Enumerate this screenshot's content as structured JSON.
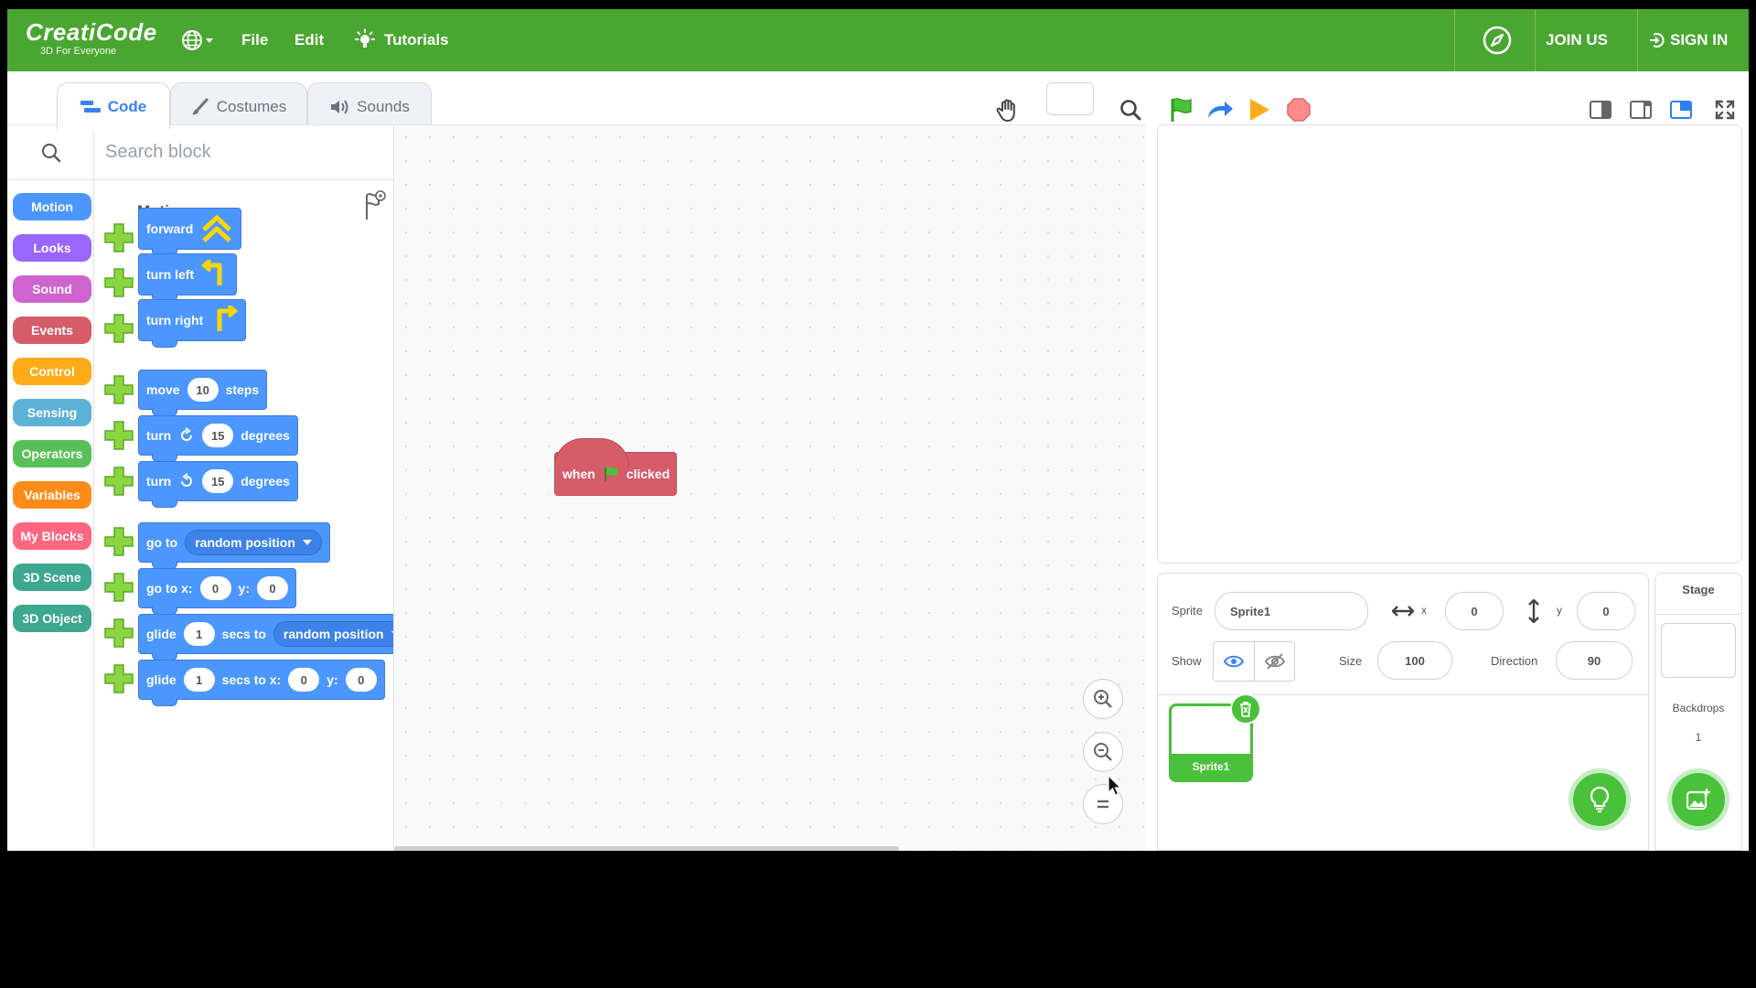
{
  "topbar": {
    "brand": "CreatiCode",
    "tagline": "3D For Everyone",
    "menu_file": "File",
    "menu_edit": "Edit",
    "menu_tutorials": "Tutorials",
    "join_us": "JOIN US",
    "sign_in": "SIGN IN"
  },
  "tabs": {
    "code": "Code",
    "costumes": "Costumes",
    "sounds": "Sounds"
  },
  "categories": [
    {
      "label": "Motion",
      "color": "#4c97ff"
    },
    {
      "label": "Looks",
      "color": "#9966ff"
    },
    {
      "label": "Sound",
      "color": "#cf63cf"
    },
    {
      "label": "Events",
      "color": "#d65c69"
    },
    {
      "label": "Control",
      "color": "#ffab19"
    },
    {
      "label": "Sensing",
      "color": "#5cb1d6"
    },
    {
      "label": "Operators",
      "color": "#59c059"
    },
    {
      "label": "Variables",
      "color": "#ff8c1a"
    },
    {
      "label": "My Blocks",
      "color": "#ff6680"
    },
    {
      "label": "3D Scene",
      "color": "#3da88f"
    },
    {
      "label": "3D Object",
      "color": "#3da88f"
    }
  ],
  "palette": {
    "search_placeholder": "Search block",
    "section_title": "Motion",
    "blocks": {
      "forward": "forward",
      "turn_left": "turn left",
      "turn_right": "turn right",
      "move": {
        "a": "move",
        "val": "10",
        "b": "steps"
      },
      "turn_cw": {
        "a": "turn",
        "val": "15",
        "b": "degrees"
      },
      "turn_ccw": {
        "a": "turn",
        "val": "15",
        "b": "degrees"
      },
      "goto": {
        "a": "go to",
        "drop": "random position"
      },
      "gotoxy": {
        "a": "go to x:",
        "x": "0",
        "b": "y:",
        "y": "0"
      },
      "glide": {
        "a": "glide",
        "val": "1",
        "b": "secs to",
        "drop": "random position"
      },
      "glidexy": {
        "a": "glide",
        "val": "1",
        "b": "secs to x:",
        "x": "0",
        "c": "y:",
        "y": "0"
      }
    }
  },
  "workspace": {
    "hat_when": "when",
    "hat_clicked": "clicked"
  },
  "sprite_info": {
    "sprite_label": "Sprite",
    "sprite_name": "Sprite1",
    "x_label": "x",
    "x": "0",
    "y_label": "y",
    "y": "0",
    "show_label": "Show",
    "size_label": "Size",
    "size": "100",
    "direction_label": "Direction",
    "direction": "90",
    "sprite_thumb_name": "Sprite1"
  },
  "stage_panel": {
    "title": "Stage",
    "backdrops_label": "Backdrops",
    "backdrops_count": "1"
  },
  "colors": {
    "topbar": "#49a630",
    "motion": "#4c97ff",
    "events": "#d65c69",
    "add_green": "#49c13a"
  }
}
